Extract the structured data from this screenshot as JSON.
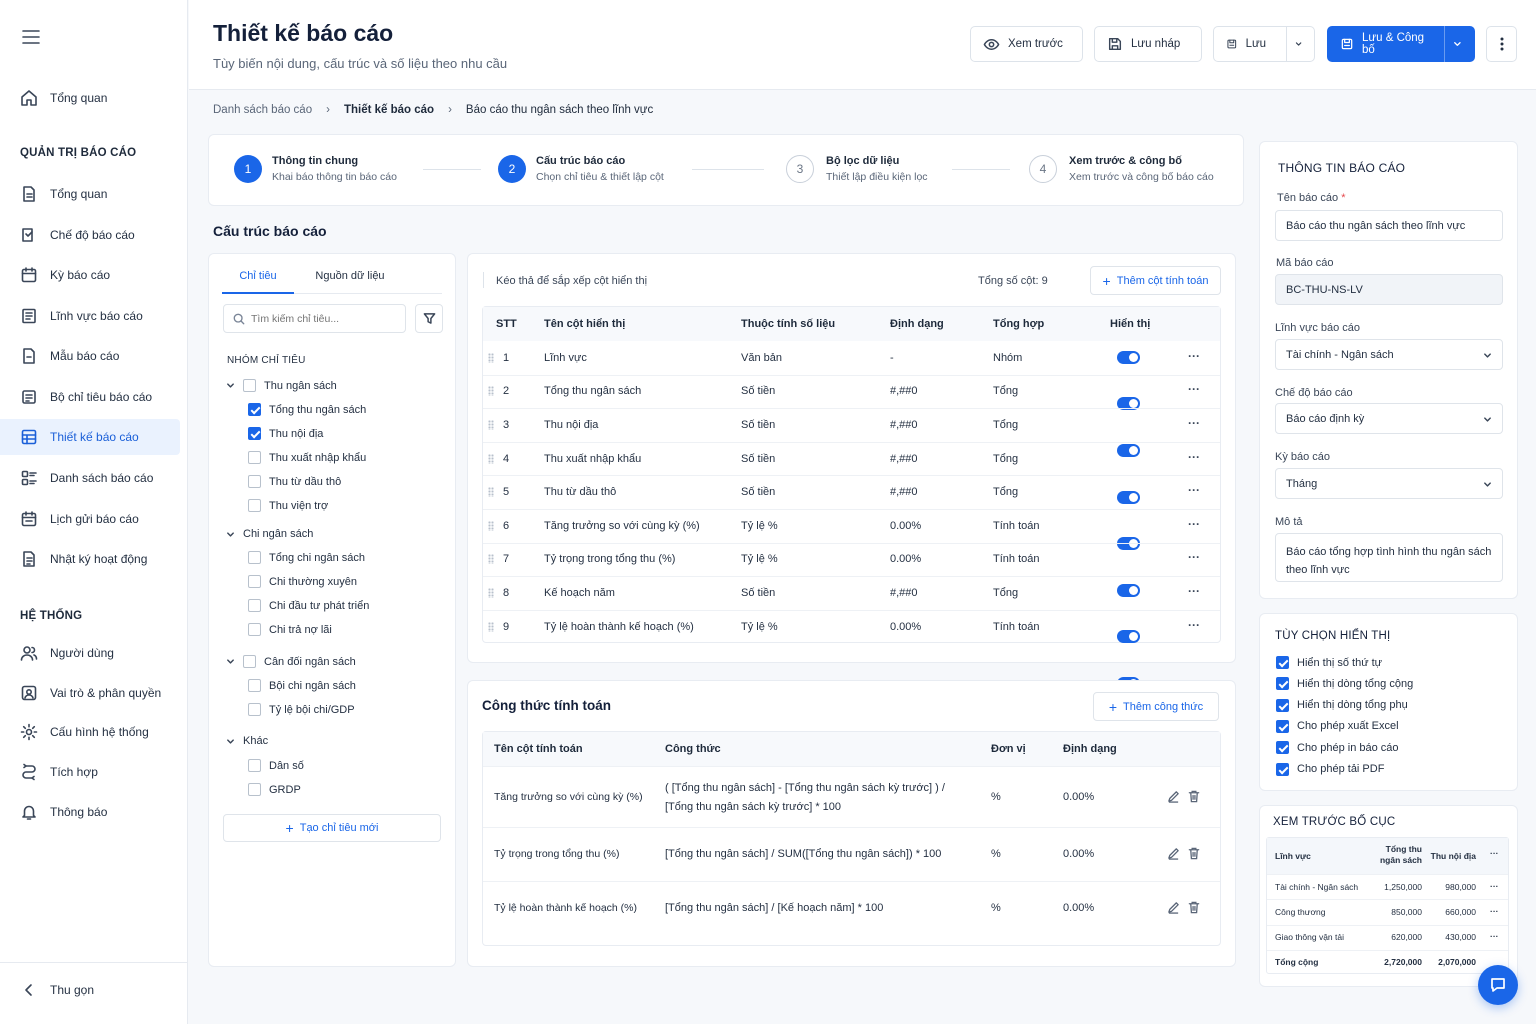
{
  "sidebar": {
    "items_top": [
      {
        "label": "Tổng quan"
      }
    ],
    "section_report": "QUẢN TRỊ BÁO CÁO",
    "items_report": [
      {
        "label": "Tổng quan"
      },
      {
        "label": "Chế độ báo cáo"
      },
      {
        "label": "Kỳ báo cáo"
      },
      {
        "label": "Lĩnh vực báo cáo"
      },
      {
        "label": "Mẫu báo cáo"
      },
      {
        "label": "Bộ chỉ tiêu báo cáo"
      },
      {
        "label": "Thiết kế báo cáo"
      },
      {
        "label": "Danh sách báo cáo"
      },
      {
        "label": "Lịch gửi báo cáo"
      },
      {
        "label": "Nhật ký hoạt động"
      }
    ],
    "section_system": "HỆ THỐNG",
    "items_system": [
      {
        "label": "Người dùng"
      },
      {
        "label": "Vai trò & phân quyền"
      },
      {
        "label": "Cấu hình hệ thống"
      },
      {
        "label": "Tích hợp"
      },
      {
        "label": "Thông báo"
      }
    ],
    "collapse": "Thu gọn"
  },
  "header": {
    "title": "Thiết kế báo cáo",
    "subtitle": "Tùy biến nội dung, cấu trúc và số liệu theo nhu cầu",
    "preview": "Xem trước",
    "draft": "Lưu nháp",
    "save": "Lưu",
    "publish": "Lưu & Công bố"
  },
  "breadcrumb": [
    "Danh sách báo cáo",
    "Thiết kế báo cáo",
    "Báo cáo thu ngân sách theo lĩnh vực"
  ],
  "steps": [
    {
      "num": "1",
      "title": "Thông tin chung",
      "sub": "Khai báo thông tin báo cáo"
    },
    {
      "num": "2",
      "title": "Cấu trúc báo cáo",
      "sub": "Chọn chỉ tiêu & thiết lập cột"
    },
    {
      "num": "3",
      "title": "Bộ lọc dữ liệu",
      "sub": "Thiết lập điều kiện lọc"
    },
    {
      "num": "4",
      "title": "Xem trước & công bố",
      "sub": "Xem trước và công bố báo cáo"
    }
  ],
  "structure_title": "Cấu trúc báo cáo",
  "left_panel": {
    "tabs": [
      "Chỉ tiêu",
      "Nguồn dữ liệu"
    ],
    "search_placeholder": "Tìm kiếm chỉ tiêu...",
    "group_label": "NHÓM CHỈ TIÊU",
    "groups": [
      {
        "label": "Thu ngân sách",
        "items": [
          {
            "label": "Tổng thu ngân sách",
            "checked": true
          },
          {
            "label": "Thu nội địa",
            "checked": true
          },
          {
            "label": "Thu xuất nhập khẩu",
            "checked": false
          },
          {
            "label": "Thu từ dầu thô",
            "checked": false
          },
          {
            "label": "Thu viện trợ",
            "checked": false
          }
        ]
      },
      {
        "label": "Chi ngân sách",
        "items": [
          {
            "label": "Tổng chi ngân sách",
            "checked": false
          },
          {
            "label": "Chi thường xuyên",
            "checked": false
          },
          {
            "label": "Chi đầu tư phát triển",
            "checked": false
          },
          {
            "label": "Chi trả nợ lãi",
            "checked": false
          }
        ]
      },
      {
        "label": "Cân đối ngân sách",
        "items": [
          {
            "label": "Bội chi ngân sách",
            "checked": false
          },
          {
            "label": "Tỷ lệ bội chi/GDP",
            "checked": false
          }
        ]
      },
      {
        "label": "Khác",
        "items": [
          {
            "label": "Dân số",
            "checked": false
          },
          {
            "label": "GRDP",
            "checked": false
          }
        ]
      }
    ],
    "create_label": "Tạo chỉ tiêu mới"
  },
  "columns": {
    "hint": "Kéo thả để sắp xếp cột hiển thị",
    "total": "Tổng số cột: 9",
    "add_label": "Thêm cột tính toán",
    "headers": [
      "STT",
      "Tên cột hiển thị",
      "Thuộc tính số liệu",
      "Định dạng",
      "Tổng hợp",
      "Hiển thị"
    ],
    "rows": [
      {
        "stt": "1",
        "name": "Lĩnh vực",
        "attr": "Văn bản",
        "format": "-",
        "agg": "Nhóm",
        "visible": true
      },
      {
        "stt": "2",
        "name": "Tổng thu ngân sách",
        "attr": "Số tiền",
        "format": "#,##0",
        "agg": "Tổng",
        "visible": true
      },
      {
        "stt": "3",
        "name": "Thu nội địa",
        "attr": "Số tiền",
        "format": "#,##0",
        "agg": "Tổng",
        "visible": true
      },
      {
        "stt": "4",
        "name": "Thu xuất nhập khẩu",
        "attr": "Số tiền",
        "format": "#,##0",
        "agg": "Tổng",
        "visible": true
      },
      {
        "stt": "5",
        "name": "Thu từ dầu thô",
        "attr": "Số tiền",
        "format": "#,##0",
        "agg": "Tổng",
        "visible": true
      },
      {
        "stt": "6",
        "name": "Tăng trưởng so với cùng kỳ (%)",
        "attr": "Tỷ lệ %",
        "format": "0.00%",
        "agg": "Tính toán",
        "visible": true
      },
      {
        "stt": "7",
        "name": "Tỷ trọng trong tổng thu (%)",
        "attr": "Tỷ lệ %",
        "format": "0.00%",
        "agg": "Tính toán",
        "visible": true
      },
      {
        "stt": "8",
        "name": "Kế hoạch năm",
        "attr": "Số tiền",
        "format": "#,##0",
        "agg": "Tổng",
        "visible": true
      },
      {
        "stt": "9",
        "name": "Tỷ lệ hoàn thành kế hoạch (%)",
        "attr": "Tỷ lệ %",
        "format": "0.00%",
        "agg": "Tính toán",
        "visible": true
      }
    ]
  },
  "formulas": {
    "title": "Công thức tính toán",
    "add_label": "Thêm công thức",
    "headers": [
      "Tên cột tính toán",
      "Công thức",
      "Đơn vị",
      "Định dạng"
    ],
    "rows": [
      {
        "name": "Tăng trưởng so với cùng kỳ (%)",
        "formula1": "( [Tổng thu ngân sách] - [Tổng thu ngân sách kỳ trước] ) /",
        "formula2": "[Tổng thu ngân sách kỳ trước] * 100",
        "unit": "%",
        "format": "0.00%"
      },
      {
        "name": "Tỷ trọng trong tổng thu (%)",
        "formula1": "[Tổng thu ngân sách] / SUM([Tổng thu ngân sách]) * 100",
        "formula2": "",
        "unit": "%",
        "format": "0.00%"
      },
      {
        "name": "Tỷ lệ hoàn thành kế hoạch (%)",
        "formula1": "[Tổng thu ngân sách] / [Kế hoạch năm] * 100",
        "formula2": "",
        "unit": "%",
        "format": "0.00%"
      }
    ]
  },
  "info": {
    "title": "THÔNG TIN BÁO CÁO",
    "name_label": "Tên báo cáo",
    "required": "*",
    "name_value": "Báo cáo thu ngân sách theo lĩnh vực",
    "code_label": "Mã báo cáo",
    "code_value": "BC-THU-NS-LV",
    "field_label": "Lĩnh vực báo cáo",
    "field_value": "Tài chính - Ngân sách",
    "mode_label": "Chế độ báo cáo",
    "mode_value": "Báo cáo định kỳ",
    "period_label": "Kỳ báo cáo",
    "period_value": "Tháng",
    "desc_label": "Mô tả",
    "desc_line1": "Báo cáo tổng hợp tình hình thu ngân sách",
    "desc_line2": "theo lĩnh vực"
  },
  "display": {
    "title": "TÙY CHỌN HIỂN THỊ",
    "options": [
      {
        "label": "Hiển thị số thứ tự",
        "checked": true
      },
      {
        "label": "Hiển thị dòng tổng cộng",
        "checked": true
      },
      {
        "label": "Hiển thị dòng tổng phụ",
        "checked": true
      },
      {
        "label": "Cho phép xuất Excel",
        "checked": true
      },
      {
        "label": "Cho phép in báo cáo",
        "checked": true
      },
      {
        "label": "Cho phép tải PDF",
        "checked": true
      }
    ]
  },
  "layout_preview": {
    "title": "XEM TRƯỚC BỐ CỤC",
    "headers": [
      "Lĩnh vực",
      "Tổng thu",
      "ngân sách",
      "Thu nội địa"
    ],
    "rows": [
      {
        "name": "Tài chính - Ngân sách",
        "total": "1,250,000",
        "domestic": "980,000"
      },
      {
        "name": "Công thương",
        "total": "850,000",
        "domestic": "660,000"
      },
      {
        "name": "Giao thông vận tải",
        "total": "620,000",
        "domestic": "430,000"
      }
    ],
    "sum_row": {
      "name": "Tổng cộng",
      "total": "2,720,000",
      "domestic": "2,070,000"
    }
  },
  "colors": {
    "accent": "#1a66e8",
    "active_bg": "#eaf2fe"
  }
}
